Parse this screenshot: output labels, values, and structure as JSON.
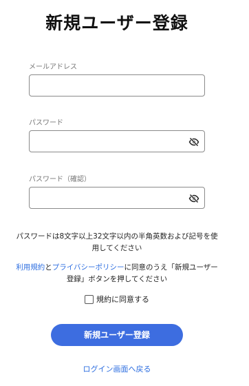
{
  "page": {
    "title": "新規ユーザー登録"
  },
  "form": {
    "email": {
      "label": "メールアドレス",
      "value": "",
      "placeholder": ""
    },
    "password": {
      "label": "パスワード",
      "value": "",
      "placeholder": "",
      "toggle_icon": "eye-slash-icon"
    },
    "password_confirm": {
      "label": "パスワード（確認）",
      "value": "",
      "placeholder": "",
      "toggle_icon": "eye-slash-icon"
    },
    "password_rule_line1": "パスワードは8文字以上32文字以内の半角英数および記号を使",
    "password_rule_line2": "用してください",
    "terms": {
      "terms_link": "利用規約",
      "and": "と",
      "privacy_link": "プライバシーポリシー",
      "after_links": "に同意のうえ「新規ユーザー",
      "line2": "登録」ボタンを押してください"
    },
    "agree_label": "規約に同意する",
    "agree_checked": false,
    "submit_label": "新規ユーザー登録",
    "back_link": "ログイン画面へ戻る"
  },
  "colors": {
    "accent": "#3d6de0",
    "link": "#2f6fe0"
  }
}
